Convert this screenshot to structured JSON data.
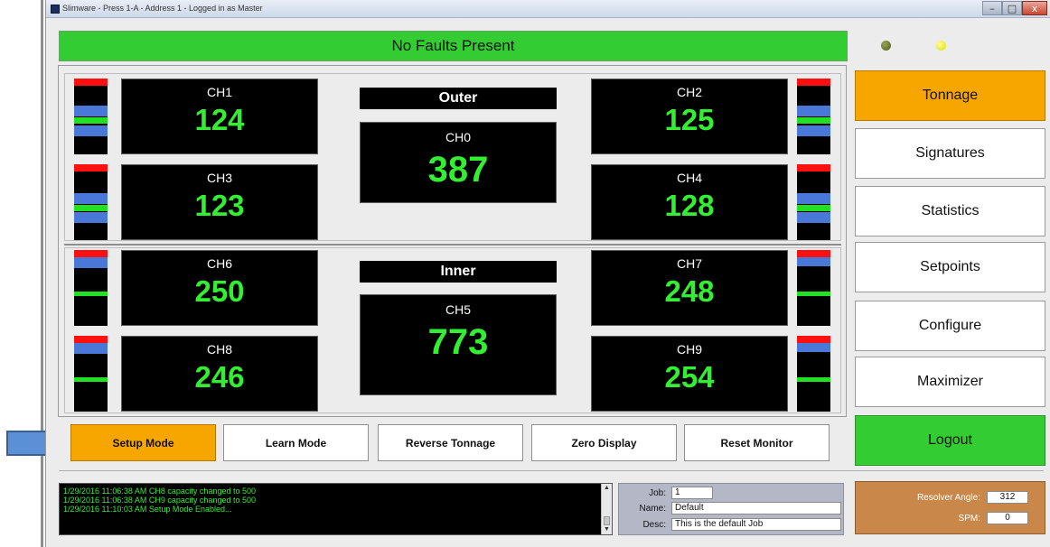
{
  "window": {
    "title": "Slimware - Press 1-A - Address 1 - Logged in as Master",
    "controls": {
      "minimize": "–",
      "maximize": "□",
      "close": "x"
    }
  },
  "fault_banner": "No Faults Present",
  "indicators": [
    {
      "name": "status-led-olive",
      "color": "#6e7a20"
    },
    {
      "name": "status-led-yellow",
      "color": "#f0f000"
    }
  ],
  "outer": {
    "heading": "Outer",
    "center": {
      "label": "CH0",
      "value": "387"
    },
    "channels": [
      {
        "label": "CH1",
        "value": "124"
      },
      {
        "label": "CH2",
        "value": "125"
      },
      {
        "label": "CH3",
        "value": "123"
      },
      {
        "label": "CH4",
        "value": "128"
      }
    ]
  },
  "inner": {
    "heading": "Inner",
    "center": {
      "label": "CH5",
      "value": "773"
    },
    "channels": [
      {
        "label": "CH6",
        "value": "250"
      },
      {
        "label": "CH7",
        "value": "248"
      },
      {
        "label": "CH8",
        "value": "246"
      },
      {
        "label": "CH9",
        "value": "254"
      }
    ]
  },
  "mode_buttons": [
    {
      "label": "Setup Mode",
      "active": true
    },
    {
      "label": "Learn Mode",
      "active": false
    },
    {
      "label": "Reverse Tonnage",
      "active": false
    },
    {
      "label": "Zero Display",
      "active": false
    },
    {
      "label": "Reset Monitor",
      "active": false
    }
  ],
  "side_menu": [
    {
      "label": "Tonnage",
      "state": "selected"
    },
    {
      "label": "Signatures",
      "state": "normal"
    },
    {
      "label": "Statistics",
      "state": "normal"
    },
    {
      "label": "Setpoints",
      "state": "normal"
    },
    {
      "label": "Configure",
      "state": "normal"
    },
    {
      "label": "Maximizer",
      "state": "normal"
    },
    {
      "label": "Logout",
      "state": "logout"
    }
  ],
  "event_log": [
    "1/29/2016 11:06:38 AM  CH8 capacity changed to 500",
    "1/29/2016 11:06:38 AM  CH9 capacity changed to 500",
    "1/29/2016 11:10:03 AM  Setup Mode Enabled..."
  ],
  "job": {
    "job_label": "Job:",
    "job_value": "1",
    "name_label": "Name:",
    "name_value": "Default",
    "desc_label": "Desc:",
    "desc_value": "This is the default Job"
  },
  "resolver": {
    "angle_label": "Resolver Angle:",
    "angle_value": "312",
    "spm_label": "SPM:",
    "spm_value": "0"
  },
  "colors": {
    "fault_ok": "#33cc33",
    "accent_orange": "#f7a600",
    "logout_green": "#33cc33",
    "readout_green": "#33ee33",
    "resolver_panel": "#c9884a",
    "job_panel": "#b4b8c6",
    "pointer_arrow": "#5b8fd6"
  }
}
